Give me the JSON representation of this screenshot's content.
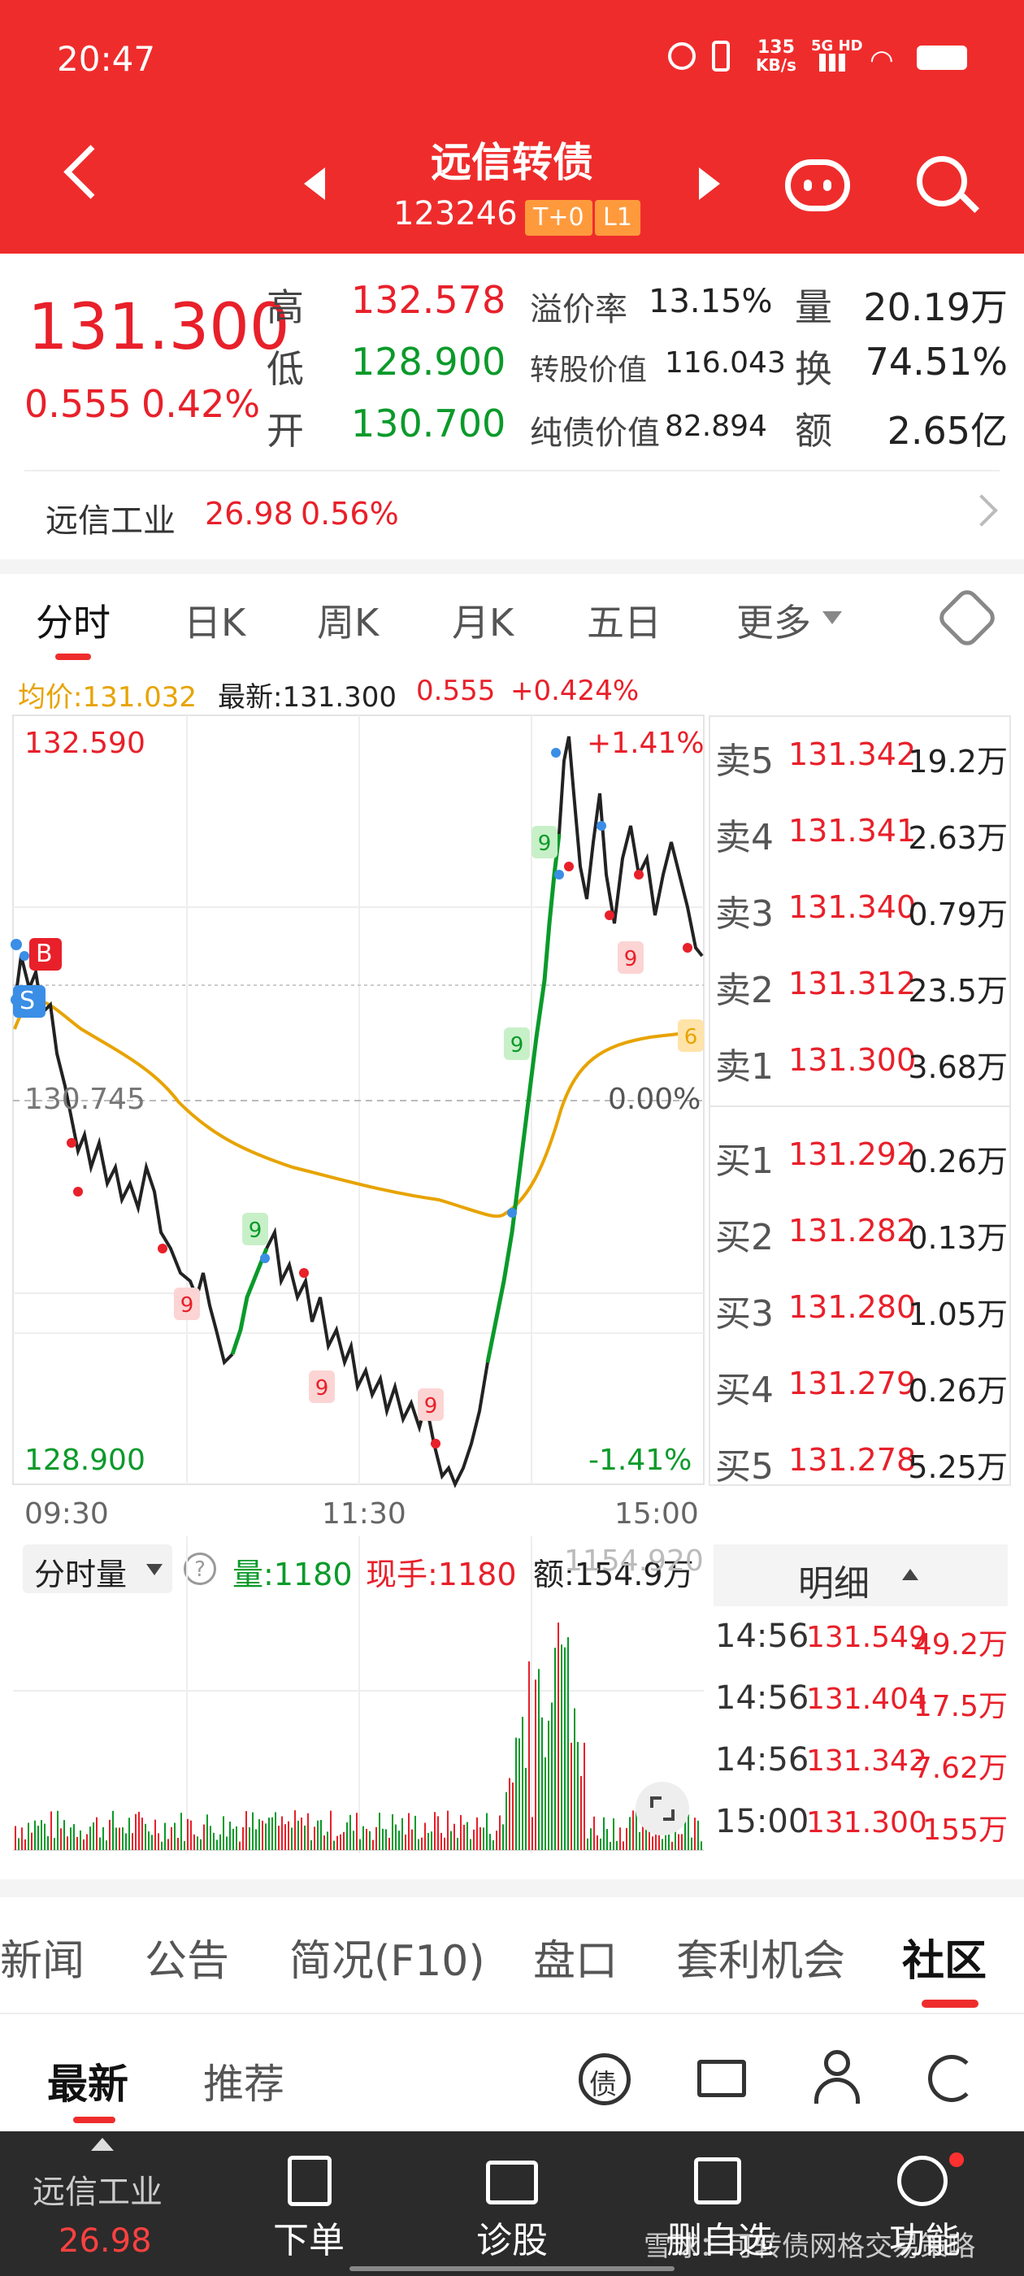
{
  "status_bar": {
    "time": "20:47",
    "net_speed_top": "135",
    "net_speed_unit": "KB/s",
    "signal": "5G HD"
  },
  "header": {
    "title": "远信转债",
    "code": "123246",
    "tag1": "T+0",
    "tag2": "L1"
  },
  "quote": {
    "price": "131.300",
    "change": "0.555",
    "change_pct": "0.42%",
    "high_label": "高",
    "high": "132.578",
    "low_label": "低",
    "low": "128.900",
    "open_label": "开",
    "open": "130.700",
    "premium_label": "溢价率",
    "premium": "13.15%",
    "conv_value_label": "转股价值",
    "conv_value": "116.043",
    "bond_value_label": "纯债价值",
    "bond_value": "82.894",
    "vol_label": "量",
    "vol": "20.19万",
    "turnover_label": "换",
    "turnover": "74.51%",
    "amount_label": "额",
    "amount": "2.65亿"
  },
  "stock_link": {
    "name": "远信工业",
    "price": "26.98",
    "pct": "0.56%"
  },
  "chart_tabs": [
    "分时",
    "日K",
    "周K",
    "月K",
    "五日",
    "更多"
  ],
  "chart_info": {
    "avg": "均价:131.032",
    "latest": "最新:131.300",
    "chg": "0.555",
    "chg_pct": "+0.424%"
  },
  "chart_labels": {
    "top_price": "132.590",
    "top_pct": "+1.41%",
    "mid_price": "130.745",
    "mid_pct": "0.00%",
    "bot_price": "128.900",
    "bot_pct": "-1.41%",
    "t_start": "09:30",
    "t_mid": "11:30",
    "t_end": "15:00",
    "buy_mark": "B",
    "sell_mark": "S"
  },
  "volume_bar": {
    "label": "分时量",
    "vol": "量:1180",
    "hand": "现手:1180",
    "amt": "额:154.9万",
    "max": "1154.920"
  },
  "order_book": {
    "asks": [
      {
        "label": "卖5",
        "price": "131.342",
        "vol": "19.2万"
      },
      {
        "label": "卖4",
        "price": "131.341",
        "vol": "2.63万"
      },
      {
        "label": "卖3",
        "price": "131.340",
        "vol": "0.79万"
      },
      {
        "label": "卖2",
        "price": "131.312",
        "vol": "23.5万"
      },
      {
        "label": "卖1",
        "price": "131.300",
        "vol": "3.68万"
      }
    ],
    "bids": [
      {
        "label": "买1",
        "price": "131.292",
        "vol": "0.26万"
      },
      {
        "label": "买2",
        "price": "131.282",
        "vol": "0.13万"
      },
      {
        "label": "买3",
        "price": "131.280",
        "vol": "1.05万"
      },
      {
        "label": "买4",
        "price": "131.279",
        "vol": "0.26万"
      },
      {
        "label": "买5",
        "price": "131.278",
        "vol": "5.25万"
      }
    ]
  },
  "details": {
    "header": "明细",
    "rows": [
      {
        "time": "14:56",
        "price": "131.549",
        "vol": "49.2万"
      },
      {
        "time": "14:56",
        "price": "131.404",
        "vol": "17.5万"
      },
      {
        "time": "14:56",
        "price": "131.342",
        "vol": "7.62万"
      },
      {
        "time": "15:00",
        "price": "131.300",
        "vol": "155万"
      }
    ]
  },
  "news_tabs": [
    "新闻",
    "公告",
    "简况(F10)",
    "盘口",
    "套利机会",
    "社区"
  ],
  "community": {
    "latest": "最新",
    "recommend": "推荐",
    "bond_icon": "债"
  },
  "bottom_nav": {
    "stock_name": "远信工业",
    "stock_price": "26.98",
    "order": "下单",
    "diagnose": "诊股",
    "remove": "删自选",
    "functions": "功能"
  },
  "watermark": "雪球：可转债网格交易策略"
}
